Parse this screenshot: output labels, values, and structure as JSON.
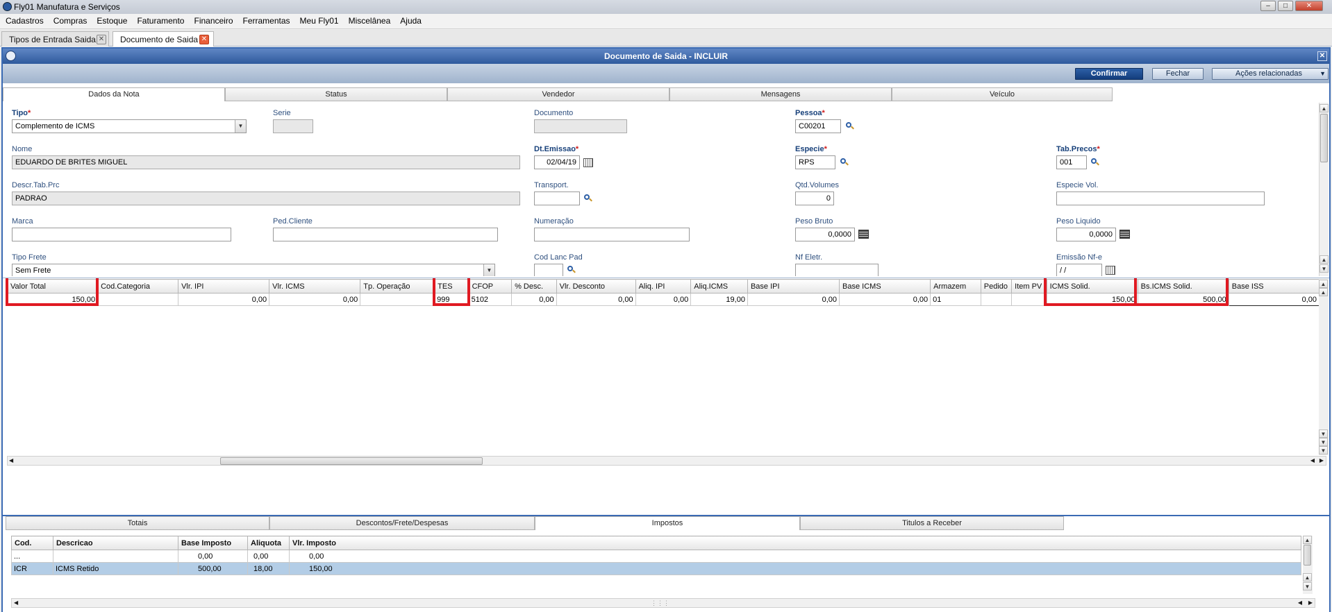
{
  "app": {
    "title": "Fly01 Manufatura e Serviços"
  },
  "menu": [
    "Cadastros",
    "Compras",
    "Estoque",
    "Faturamento",
    "Financeiro",
    "Ferramentas",
    "Meu Fly01",
    "Miscelânea",
    "Ajuda"
  ],
  "tabs": [
    {
      "label": "Tipos de Entrada Saida"
    },
    {
      "label": "Documento de Saida"
    }
  ],
  "window": {
    "title": "Documento de Saida - INCLUIR"
  },
  "actions": {
    "confirm": "Confirmar",
    "close": "Fechar",
    "related": "Ações relacionadas"
  },
  "form_tabs": [
    "Dados da Nota",
    "Status",
    "Vendedor",
    "Mensagens",
    "Veículo"
  ],
  "fields": {
    "tipo": {
      "label": "Tipo",
      "value": "Complemento de ICMS"
    },
    "serie": {
      "label": "Serie",
      "value": ""
    },
    "documento": {
      "label": "Documento",
      "value": ""
    },
    "pessoa": {
      "label": "Pessoa",
      "value": "C00201"
    },
    "nome": {
      "label": "Nome",
      "value": "EDUARDO DE BRITES MIGUEL"
    },
    "dt_emissao": {
      "label": "Dt.Emissao",
      "value": "02/04/19"
    },
    "especie": {
      "label": "Especie",
      "value": "RPS"
    },
    "tab_precos": {
      "label": "Tab.Precos",
      "value": "001"
    },
    "descr_tab_prc": {
      "label": "Descr.Tab.Prc",
      "value": "PADRAO"
    },
    "transport": {
      "label": "Transport.",
      "value": ""
    },
    "qtd_volumes": {
      "label": "Qtd.Volumes",
      "value": "0"
    },
    "especie_vol": {
      "label": "Especie Vol.",
      "value": ""
    },
    "marca": {
      "label": "Marca",
      "value": ""
    },
    "ped_cliente": {
      "label": "Ped.Cliente",
      "value": ""
    },
    "numeracao": {
      "label": "Numeração",
      "value": ""
    },
    "peso_bruto": {
      "label": "Peso Bruto",
      "value": "0,0000"
    },
    "peso_liquido": {
      "label": "Peso Liquido",
      "value": "0,0000"
    },
    "tipo_frete": {
      "label": "Tipo Frete",
      "value": "Sem Frete"
    },
    "cod_lanc_pad": {
      "label": "Cod Lanc Pad",
      "value": ""
    },
    "nf_eletr": {
      "label": "Nf Eletr.",
      "value": ""
    },
    "emissao_nfe": {
      "label": "Emissão Nf-e",
      "value": " /  /"
    }
  },
  "items_grid": {
    "columns": [
      "Valor Total",
      "Cod.Categoria",
      "Vlr. IPI",
      "Vlr. ICMS",
      "Tp. Operação",
      "TES",
      "CFOP",
      "% Desc.",
      "Vlr. Desconto",
      "Aliq. IPI",
      "Aliq.ICMS",
      "Base IPI",
      "Base ICMS",
      "Armazem",
      "Pedido",
      "Item PV",
      "ICMS Solid.",
      "Bs.ICMS Solid.",
      "Base ISS"
    ],
    "rows": [
      [
        "150,00",
        "",
        "0,00",
        "0,00",
        "",
        "999",
        "5102",
        "0,00",
        "0,00",
        "0,00",
        "19,00",
        "0,00",
        "0,00",
        "01",
        "",
        "",
        "150,00",
        "500,00",
        "0,00"
      ]
    ]
  },
  "bottom_tabs": [
    "Totais",
    "Descontos/Frete/Despesas",
    "Impostos",
    "Titulos a Receber"
  ],
  "taxes_grid": {
    "columns": [
      "Cod.",
      "Descricao",
      "Base Imposto",
      "Aliquota",
      "Vlr. Imposto"
    ],
    "rows": [
      [
        "...",
        "",
        "0,00",
        "0,00",
        "0,00"
      ],
      [
        "ICR",
        "ICMS Retido",
        "500,00",
        "18,00",
        "150,00"
      ]
    ]
  },
  "colors": {
    "highlight": "#e01a22",
    "accent": "#2f5a9d",
    "selected_row": "#b3cde6"
  }
}
